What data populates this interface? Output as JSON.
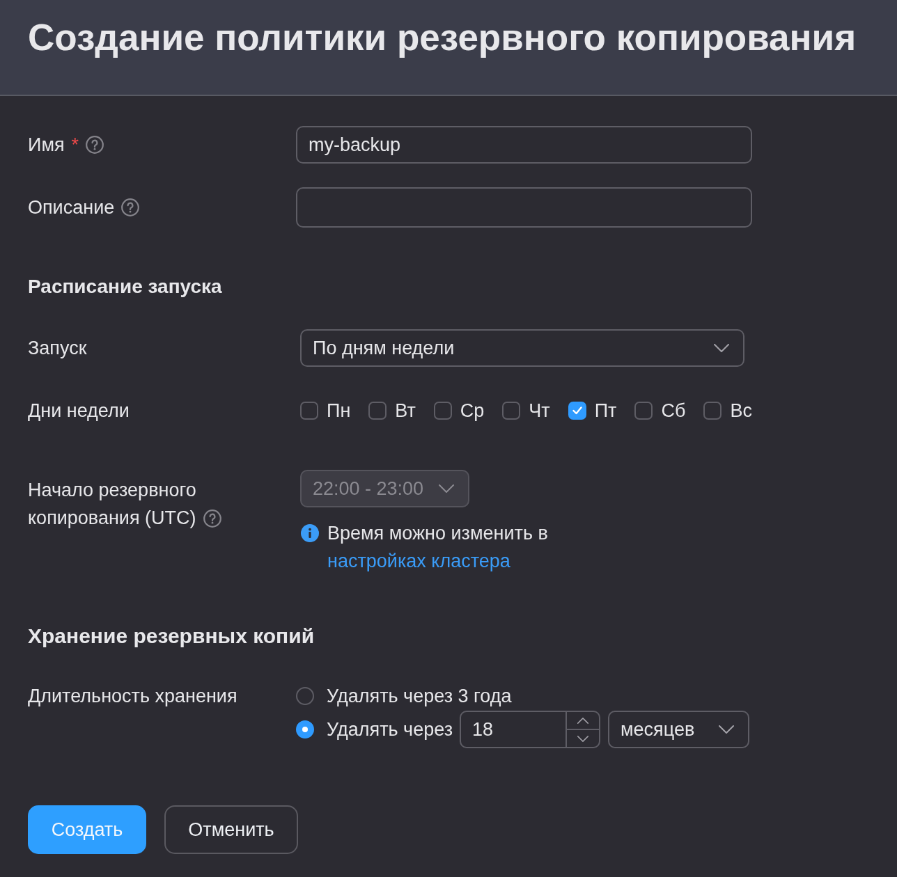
{
  "header": {
    "title": "Создание политики резервного копирования"
  },
  "fields": [
    {
      "label": "Имя",
      "required_mark": "*",
      "help": true,
      "value": "my-backup"
    },
    {
      "label": "Описание",
      "help": true
    }
  ],
  "schedule": {
    "title": "Расписание запуска",
    "launch": {
      "label": "Запуск",
      "value": "По дням недели"
    },
    "days": {
      "label": "Дни недели",
      "items": [
        {
          "label": "Пн",
          "checked": false
        },
        {
          "label": "Вт",
          "checked": false
        },
        {
          "label": "Ср",
          "checked": false
        },
        {
          "label": "Чт",
          "checked": false
        },
        {
          "label": "Пт",
          "checked": true
        },
        {
          "label": "Сб",
          "checked": false
        },
        {
          "label": "Вс",
          "checked": false
        }
      ]
    },
    "start": {
      "label": "Начало резервного копирования (UTC)",
      "help": true,
      "value": "22:00 - 23:00",
      "disabled": true,
      "hint": {
        "text": "Время можно изменить в ",
        "link": "настройках кластера"
      }
    }
  },
  "retention": {
    "title": "Хранение резервных копий",
    "label": "Длительность хранения",
    "options": [
      {
        "kind": "preset",
        "label": "Удалять через 3 года",
        "selected": false
      },
      {
        "kind": "custom",
        "label": "Удалять через",
        "selected": true,
        "value": "18",
        "unit": "месяцев"
      }
    ]
  },
  "buttons": [
    {
      "kind": "primary",
      "label": "Создать"
    },
    {
      "kind": "secondary",
      "label": "Отменить"
    }
  ]
}
